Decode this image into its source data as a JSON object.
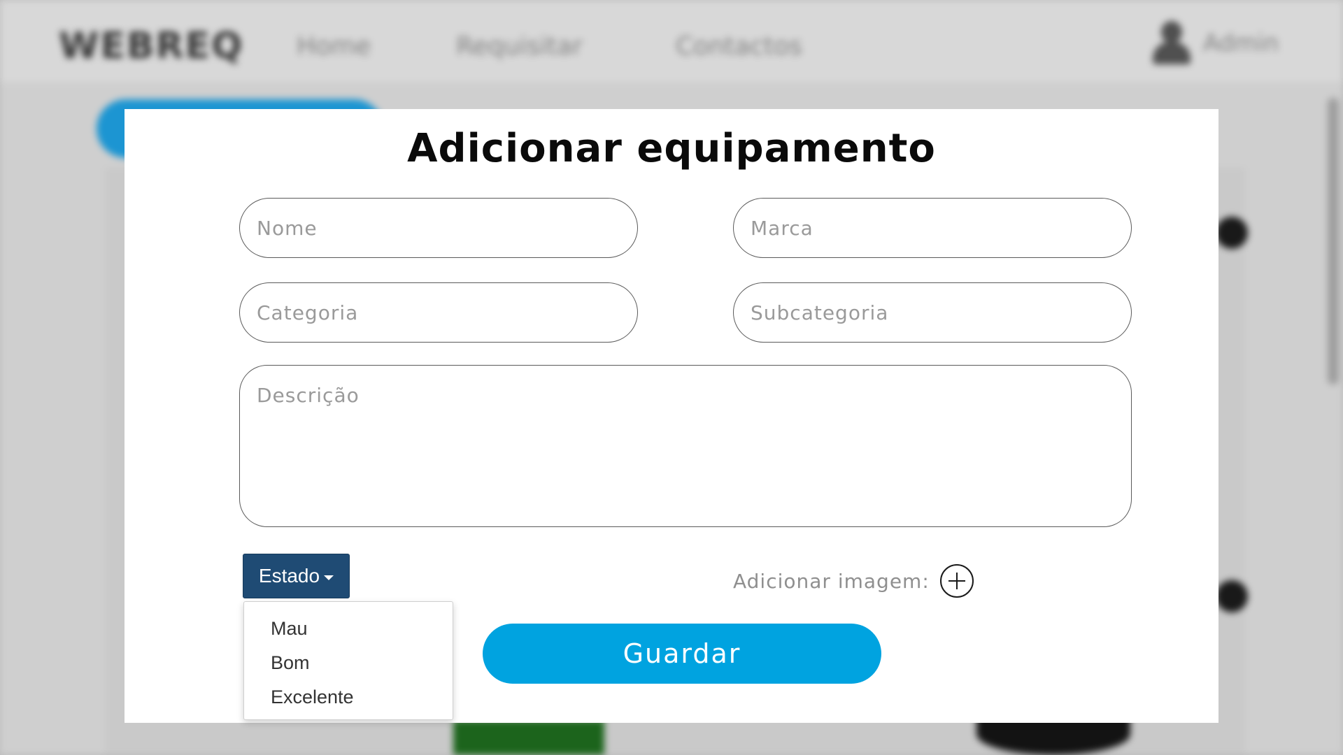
{
  "background": {
    "brand": "WEBREQ",
    "nav": [
      "Home",
      "Requisitar",
      "Contactos"
    ],
    "user_label": "Admin"
  },
  "modal": {
    "title": "Adicionar equipamento",
    "fields": {
      "nome_placeholder": "Nome",
      "marca_placeholder": "Marca",
      "categoria_placeholder": "Categoria",
      "subcategoria_placeholder": "Subcategoria",
      "descricao_placeholder": "Descrição"
    },
    "estado": {
      "label": "Estado",
      "options": [
        "Mau",
        "Bom",
        "Excelente"
      ]
    },
    "add_image_label": "Adicionar imagem:",
    "save_label": "Guardar"
  },
  "icons": {
    "add_image": "plus-circle-icon",
    "caret": "caret-down-icon",
    "user": "user-icon"
  },
  "colors": {
    "primary": "#00a3e0",
    "estado_button": "#1f4b74"
  }
}
